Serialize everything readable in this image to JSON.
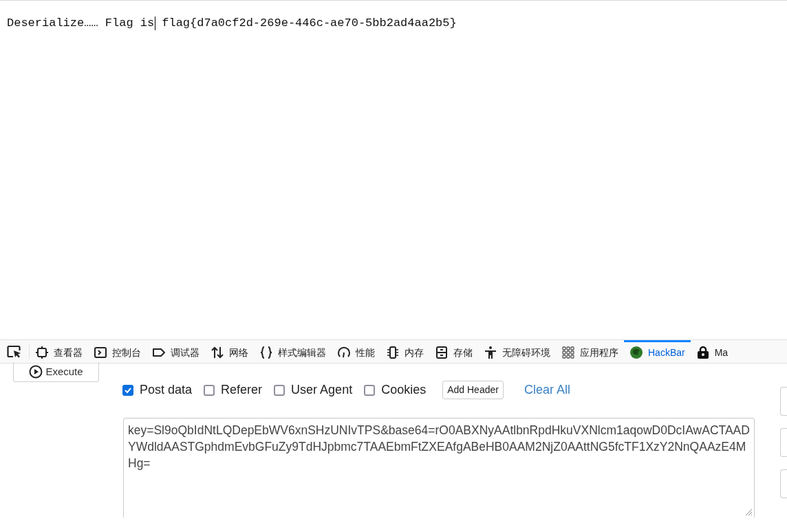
{
  "page": {
    "text": "Deserialize…… Flag is",
    "flag": "flag{d7a0cf2d-269e-446c-ae70-5bb2ad4aa2b5}"
  },
  "devtools_tabs": [
    {
      "kind": "inspector",
      "label": "查看器",
      "selected": false
    },
    {
      "kind": "console",
      "label": "控制台",
      "selected": false
    },
    {
      "kind": "debugger",
      "label": "调试器",
      "selected": false
    },
    {
      "kind": "network",
      "label": "网络",
      "selected": false
    },
    {
      "kind": "style",
      "label": "样式编辑器",
      "selected": false
    },
    {
      "kind": "performance",
      "label": "性能",
      "selected": false
    },
    {
      "kind": "memory",
      "label": "内存",
      "selected": false
    },
    {
      "kind": "storage",
      "label": "存储",
      "selected": false
    },
    {
      "kind": "accessibility",
      "label": "无障碍环境",
      "selected": false
    },
    {
      "kind": "apps",
      "label": "应用程序",
      "selected": false
    },
    {
      "kind": "hackbar",
      "label": "HackBar",
      "selected": true
    },
    {
      "kind": "lock",
      "label": "Ma",
      "selected": false
    }
  ],
  "hackbar": {
    "execute": "Execute",
    "options": [
      {
        "label": "Post data",
        "checked": true
      },
      {
        "label": "Referer",
        "checked": false
      },
      {
        "label": "User Agent",
        "checked": false
      },
      {
        "label": "Cookies",
        "checked": false
      }
    ],
    "add_header": "Add Header",
    "clear_all": "Clear All",
    "post_body": "key=Sl9oQbIdNtLQDepEbWV6xnSHzUNIvTPS&base64=rO0ABXNyAAtlbnRpdHkuVXNlcm1aqowD0DcIAwACTAADYWdldAASTGphdmEvbGFuZy9TdHJpbmc7TAAEbmFtZXEAfgABeHB0AAM2NjZ0AAttNG5fcTF1XzY2NnQAAzE4MHg="
  }
}
